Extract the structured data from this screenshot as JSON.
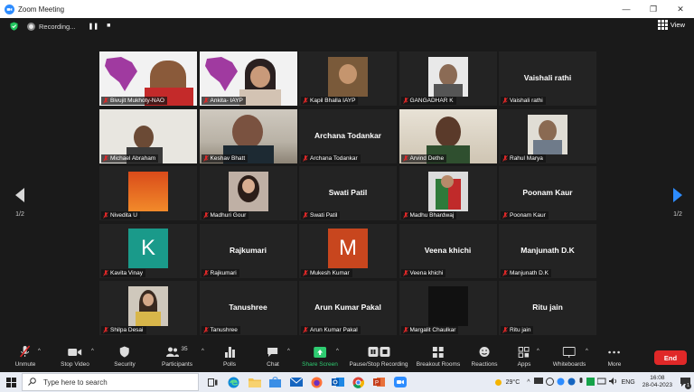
{
  "window": {
    "title": "Zoom Meeting",
    "minimize": "—",
    "restore": "❐",
    "close": "✕"
  },
  "topbar": {
    "recording_label": "Recording...",
    "pause": "❚❚",
    "stop": "■",
    "view_label": "View"
  },
  "pages": {
    "indicator": "1/2"
  },
  "tiles": [
    {
      "name": "Bivujit Mukhoty-NAO",
      "kind": "video-logo",
      "active": true
    },
    {
      "name": "Ankita- IAYP",
      "kind": "video-logo"
    },
    {
      "name": "Kapil Bhalla IAYP",
      "kind": "photo"
    },
    {
      "name": "GANGADHAR K",
      "kind": "photo"
    },
    {
      "name": "Vaishali rathi",
      "kind": "name",
      "bigname": "Vaishali rathi"
    },
    {
      "name": "Michael Abraham",
      "kind": "video"
    },
    {
      "name": "Keshav Bhatt",
      "kind": "video"
    },
    {
      "name": "Archana Todankar",
      "kind": "name",
      "bigname": "Archana Todankar"
    },
    {
      "name": "Arvind Dethe",
      "kind": "video"
    },
    {
      "name": "Rahul Marya",
      "kind": "photo"
    },
    {
      "name": "Nivedita U",
      "kind": "orange"
    },
    {
      "name": "Madhuri Gour",
      "kind": "photo"
    },
    {
      "name": "Swati Patil",
      "kind": "name",
      "bigname": "Swati Patil"
    },
    {
      "name": "Madhu Bhardwaj",
      "kind": "photo"
    },
    {
      "name": "Poonam Kaur",
      "kind": "name",
      "bigname": "Poonam Kaur"
    },
    {
      "name": "Kavita Vinay",
      "kind": "letter",
      "letter": "K",
      "color": "#1a9a8a"
    },
    {
      "name": "Rajkumari",
      "kind": "name",
      "bigname": "Rajkumari"
    },
    {
      "name": "Mukesh Kumar",
      "kind": "letter",
      "letter": "M",
      "color": "#c8461e"
    },
    {
      "name": "Veena khichi",
      "kind": "name",
      "bigname": "Veena khichi"
    },
    {
      "name": "Manjunath D.K",
      "kind": "name",
      "bigname": "Manjunath D.K"
    },
    {
      "name": "Shilpa Desai",
      "kind": "photo"
    },
    {
      "name": "Tanushree",
      "kind": "name",
      "bigname": "Tanushree"
    },
    {
      "name": "Arun Kumar Pakal",
      "kind": "name",
      "bigname": "Arun Kumar Pakal"
    },
    {
      "name": "Margalit Chaulkar",
      "kind": "dark"
    },
    {
      "name": "Ritu jain",
      "kind": "name",
      "bigname": "Ritu jain"
    }
  ],
  "toolbar": {
    "unmute": "Unmute",
    "stop_video": "Stop Video",
    "security": "Security",
    "participants": "Participants",
    "participants_count": "35",
    "polls": "Polls",
    "chat": "Chat",
    "share_screen": "Share Screen",
    "pause_recording": "Pause/Stop Recording",
    "breakout": "Breakout Rooms",
    "reactions": "Reactions",
    "apps": "Apps",
    "whiteboards": "Whiteboards",
    "more": "More",
    "end": "End"
  },
  "taskbar": {
    "search_placeholder": "Type here to search",
    "weather": "29°C",
    "lang": "ENG",
    "time": "16:08",
    "date": "28-04-2023",
    "notif_count": "1"
  },
  "colors": {
    "accent": "#2d8cff",
    "end": "#e02828",
    "share": "#2ecc71",
    "active_border": "#e9e14a"
  }
}
